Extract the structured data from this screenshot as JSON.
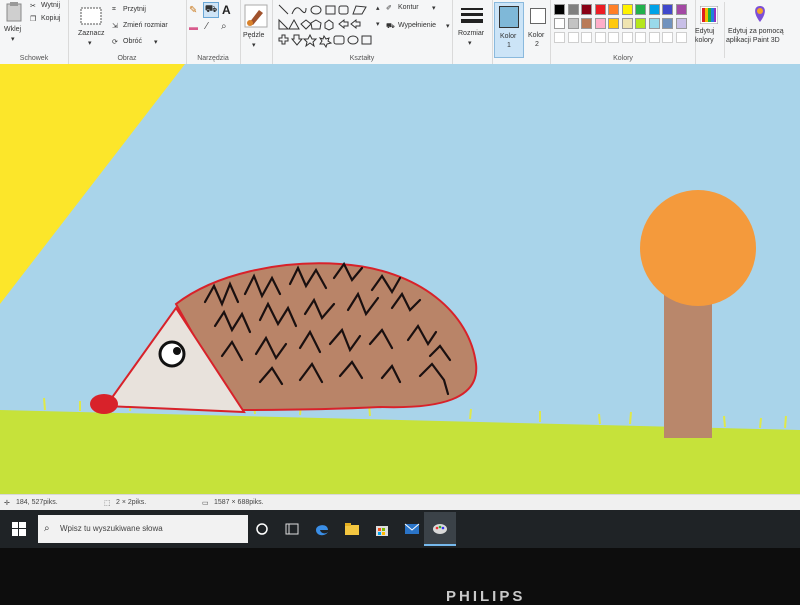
{
  "ribbon": {
    "clipboard": {
      "paste_label": "Wklej",
      "cut_label": "Wytnij",
      "copy_label": "Kopiuj",
      "group_label": "Schowek"
    },
    "image": {
      "select_label": "Zaznacz",
      "crop_label": "Przytnij",
      "resize_label": "Zmień rozmiar",
      "rotate_label": "Obróć",
      "group_label": "Obraz"
    },
    "tools": {
      "group_label": "Narzędzia"
    },
    "brushes": {
      "label": "Pędzle"
    },
    "shapes": {
      "group_label": "Kształty",
      "outline_label": "Kontur",
      "fill_label": "Wypełnienie"
    },
    "size": {
      "label": "Rozmiar"
    },
    "color1": {
      "label_line1": "Kolor",
      "label_line2": "1",
      "color": "#7fb8d8"
    },
    "color2": {
      "label_line1": "Kolor",
      "label_line2": "2",
      "color": "#ffffff"
    },
    "colors": {
      "group_label": "Kolory",
      "row1": [
        "#000000",
        "#7f7f7f",
        "#880015",
        "#ed1c24",
        "#ff7f27",
        "#fff200",
        "#22b14c",
        "#00a2e8",
        "#3f48cc",
        "#a349a4"
      ],
      "row2": [
        "#ffffff",
        "#c3c3c3",
        "#b97a57",
        "#ffaec9",
        "#ffc90e",
        "#efe4b0",
        "#b5e61d",
        "#99d9ea",
        "#7092be",
        "#c8bfe7"
      ]
    },
    "edit_colors": {
      "label_line1": "Edytuj",
      "label_line2": "kolory"
    },
    "paint3d": {
      "label_line1": "Edytuj za pomocą",
      "label_line2": "aplikacji Paint 3D"
    }
  },
  "status": {
    "cursor": "184, 527piks.",
    "selection": "2 × 2piks.",
    "size": "1587 × 688piks."
  },
  "taskbar": {
    "search_placeholder": "Wpisz tu wyszukiwane słowa"
  },
  "monitor": {
    "brand": "PHILIPS"
  },
  "palette": {
    "sky": "#a9d4ea",
    "sun": "#fce62a",
    "grass": "#c6e23a",
    "hedgehog_body": "#b98468",
    "hedgehog_outline": "#d8222a",
    "tree_top": "#f49a3c",
    "tree_trunk": "#b9876b"
  }
}
